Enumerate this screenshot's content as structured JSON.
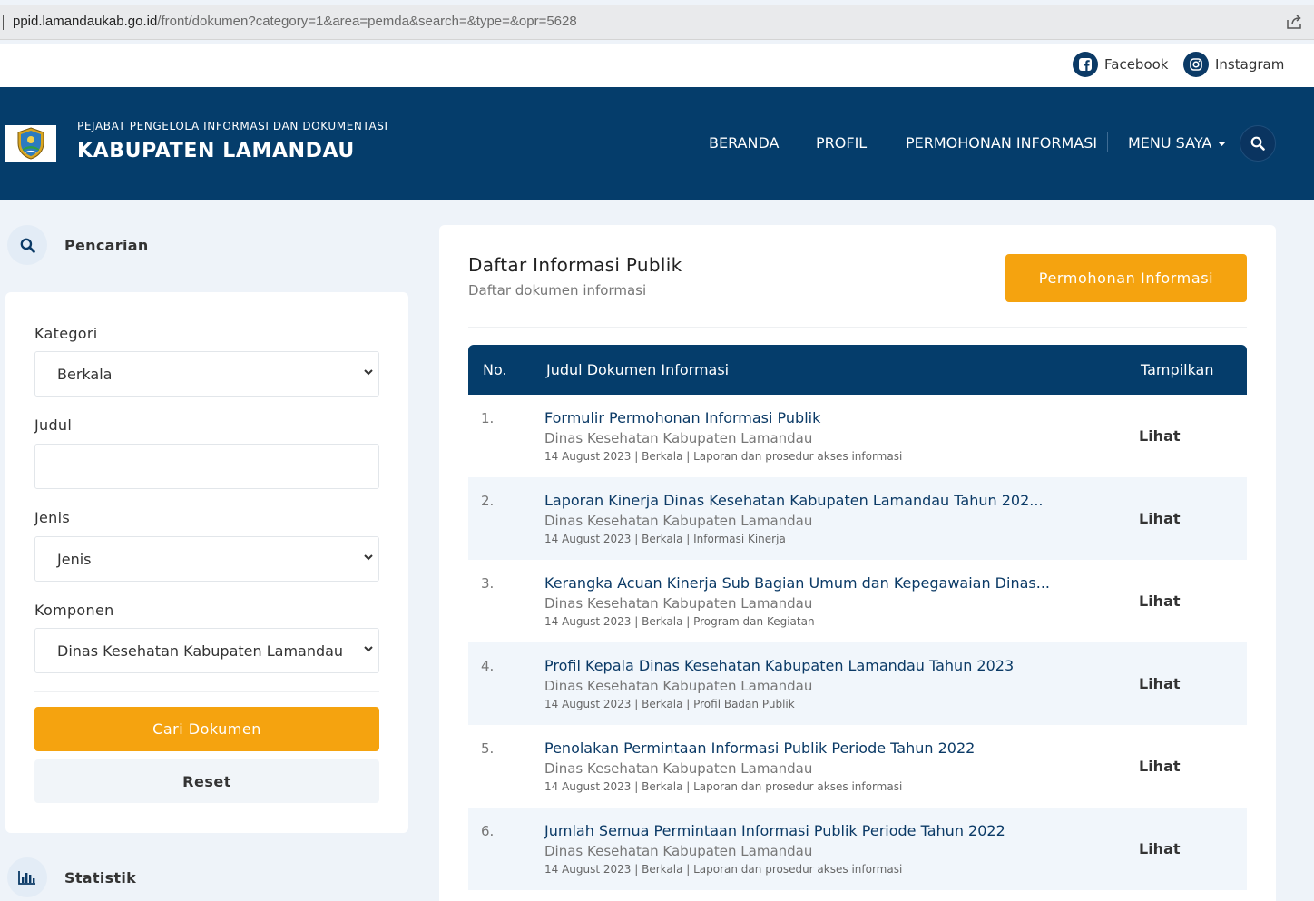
{
  "browser": {
    "url_host": "ppid.lamandaukab.go.id",
    "url_path": "/front/dokumen?category=1&area=pemda&search=&type=&opr=5628"
  },
  "social": [
    {
      "label": "Facebook",
      "icon": "facebook-icon"
    },
    {
      "label": "Instagram",
      "icon": "instagram-icon"
    }
  ],
  "header": {
    "subtitle": "PEJABAT PENGELOLA INFORMASI DAN DOKUMENTASI",
    "title": "KABUPATEN LAMANDAU",
    "nav": [
      {
        "label": "BERANDA"
      },
      {
        "label": "PROFIL"
      },
      {
        "label": "PERMOHONAN INFORMASI"
      },
      {
        "label": "MENU SAYA"
      }
    ]
  },
  "sidebar": {
    "search_title": "Pencarian",
    "stats_title": "Statistik",
    "form": {
      "kategori_label": "Kategori",
      "kategori_value": "Berkala",
      "judul_label": "Judul",
      "judul_value": "",
      "jenis_label": "Jenis",
      "jenis_value": "Jenis",
      "komponen_label": "Komponen",
      "komponen_value": "Dinas Kesehatan Kabupaten Lamandau",
      "submit_label": "Cari Dokumen",
      "reset_label": "Reset"
    }
  },
  "main": {
    "title": "Daftar Informasi Publik",
    "subtitle": "Daftar dokumen informasi",
    "request_button": "Permohonan Informasi",
    "columns": {
      "no": "No.",
      "title": "Judul Dokumen Informasi",
      "view": "Tampilkan"
    },
    "rows": [
      {
        "no": "1.",
        "title": "Formulir Permohonan Informasi Publik",
        "org": "Dinas Kesehatan Kabupaten Lamandau",
        "meta": "14 August 2023 | Berkala | Laporan dan prosedur akses informasi",
        "action": "Lihat"
      },
      {
        "no": "2.",
        "title": "Laporan Kinerja Dinas Kesehatan Kabupaten Lamandau Tahun 202...",
        "org": "Dinas Kesehatan Kabupaten Lamandau",
        "meta": "14 August 2023 | Berkala | Informasi Kinerja",
        "action": "Lihat"
      },
      {
        "no": "3.",
        "title": "Kerangka Acuan Kinerja Sub Bagian Umum dan Kepegawaian Dinas...",
        "org": "Dinas Kesehatan Kabupaten Lamandau",
        "meta": "14 August 2023 | Berkala | Program dan Kegiatan",
        "action": "Lihat"
      },
      {
        "no": "4.",
        "title": "Profil Kepala Dinas Kesehatan Kabupaten Lamandau Tahun 2023",
        "org": "Dinas Kesehatan Kabupaten Lamandau",
        "meta": "14 August 2023 | Berkala | Profil Badan Publik",
        "action": "Lihat"
      },
      {
        "no": "5.",
        "title": "Penolakan Permintaan Informasi Publik Periode Tahun 2022",
        "org": "Dinas Kesehatan Kabupaten Lamandau",
        "meta": "14 August 2023 | Berkala | Laporan dan prosedur akses informasi",
        "action": "Lihat"
      },
      {
        "no": "6.",
        "title": "Jumlah Semua Permintaan Informasi Publik Periode Tahun 2022",
        "org": "Dinas Kesehatan Kabupaten Lamandau",
        "meta": "14 August 2023 | Berkala | Laporan dan prosedur akses informasi",
        "action": "Lihat"
      }
    ]
  },
  "colors": {
    "navy": "#053d6b",
    "accent": "#f5a30f",
    "background": "#eef3f9"
  }
}
